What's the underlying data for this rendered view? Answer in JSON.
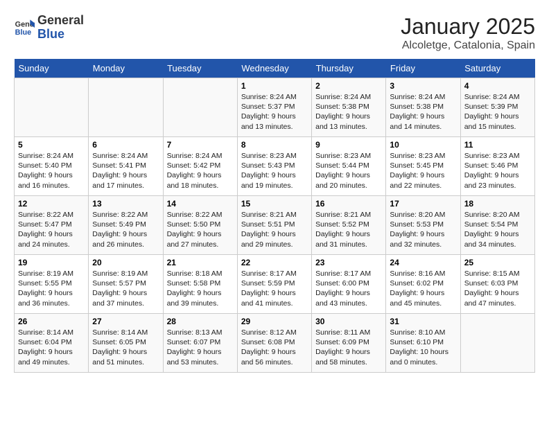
{
  "header": {
    "logo_general": "General",
    "logo_blue": "Blue",
    "month_title": "January 2025",
    "location": "Alcoletge, Catalonia, Spain"
  },
  "days_of_week": [
    "Sunday",
    "Monday",
    "Tuesday",
    "Wednesday",
    "Thursday",
    "Friday",
    "Saturday"
  ],
  "weeks": [
    [
      {
        "num": "",
        "info": ""
      },
      {
        "num": "",
        "info": ""
      },
      {
        "num": "",
        "info": ""
      },
      {
        "num": "1",
        "info": "Sunrise: 8:24 AM\nSunset: 5:37 PM\nDaylight: 9 hours\nand 13 minutes."
      },
      {
        "num": "2",
        "info": "Sunrise: 8:24 AM\nSunset: 5:38 PM\nDaylight: 9 hours\nand 13 minutes."
      },
      {
        "num": "3",
        "info": "Sunrise: 8:24 AM\nSunset: 5:38 PM\nDaylight: 9 hours\nand 14 minutes."
      },
      {
        "num": "4",
        "info": "Sunrise: 8:24 AM\nSunset: 5:39 PM\nDaylight: 9 hours\nand 15 minutes."
      }
    ],
    [
      {
        "num": "5",
        "info": "Sunrise: 8:24 AM\nSunset: 5:40 PM\nDaylight: 9 hours\nand 16 minutes."
      },
      {
        "num": "6",
        "info": "Sunrise: 8:24 AM\nSunset: 5:41 PM\nDaylight: 9 hours\nand 17 minutes."
      },
      {
        "num": "7",
        "info": "Sunrise: 8:24 AM\nSunset: 5:42 PM\nDaylight: 9 hours\nand 18 minutes."
      },
      {
        "num": "8",
        "info": "Sunrise: 8:23 AM\nSunset: 5:43 PM\nDaylight: 9 hours\nand 19 minutes."
      },
      {
        "num": "9",
        "info": "Sunrise: 8:23 AM\nSunset: 5:44 PM\nDaylight: 9 hours\nand 20 minutes."
      },
      {
        "num": "10",
        "info": "Sunrise: 8:23 AM\nSunset: 5:45 PM\nDaylight: 9 hours\nand 22 minutes."
      },
      {
        "num": "11",
        "info": "Sunrise: 8:23 AM\nSunset: 5:46 PM\nDaylight: 9 hours\nand 23 minutes."
      }
    ],
    [
      {
        "num": "12",
        "info": "Sunrise: 8:22 AM\nSunset: 5:47 PM\nDaylight: 9 hours\nand 24 minutes."
      },
      {
        "num": "13",
        "info": "Sunrise: 8:22 AM\nSunset: 5:49 PM\nDaylight: 9 hours\nand 26 minutes."
      },
      {
        "num": "14",
        "info": "Sunrise: 8:22 AM\nSunset: 5:50 PM\nDaylight: 9 hours\nand 27 minutes."
      },
      {
        "num": "15",
        "info": "Sunrise: 8:21 AM\nSunset: 5:51 PM\nDaylight: 9 hours\nand 29 minutes."
      },
      {
        "num": "16",
        "info": "Sunrise: 8:21 AM\nSunset: 5:52 PM\nDaylight: 9 hours\nand 31 minutes."
      },
      {
        "num": "17",
        "info": "Sunrise: 8:20 AM\nSunset: 5:53 PM\nDaylight: 9 hours\nand 32 minutes."
      },
      {
        "num": "18",
        "info": "Sunrise: 8:20 AM\nSunset: 5:54 PM\nDaylight: 9 hours\nand 34 minutes."
      }
    ],
    [
      {
        "num": "19",
        "info": "Sunrise: 8:19 AM\nSunset: 5:55 PM\nDaylight: 9 hours\nand 36 minutes."
      },
      {
        "num": "20",
        "info": "Sunrise: 8:19 AM\nSunset: 5:57 PM\nDaylight: 9 hours\nand 37 minutes."
      },
      {
        "num": "21",
        "info": "Sunrise: 8:18 AM\nSunset: 5:58 PM\nDaylight: 9 hours\nand 39 minutes."
      },
      {
        "num": "22",
        "info": "Sunrise: 8:17 AM\nSunset: 5:59 PM\nDaylight: 9 hours\nand 41 minutes."
      },
      {
        "num": "23",
        "info": "Sunrise: 8:17 AM\nSunset: 6:00 PM\nDaylight: 9 hours\nand 43 minutes."
      },
      {
        "num": "24",
        "info": "Sunrise: 8:16 AM\nSunset: 6:02 PM\nDaylight: 9 hours\nand 45 minutes."
      },
      {
        "num": "25",
        "info": "Sunrise: 8:15 AM\nSunset: 6:03 PM\nDaylight: 9 hours\nand 47 minutes."
      }
    ],
    [
      {
        "num": "26",
        "info": "Sunrise: 8:14 AM\nSunset: 6:04 PM\nDaylight: 9 hours\nand 49 minutes."
      },
      {
        "num": "27",
        "info": "Sunrise: 8:14 AM\nSunset: 6:05 PM\nDaylight: 9 hours\nand 51 minutes."
      },
      {
        "num": "28",
        "info": "Sunrise: 8:13 AM\nSunset: 6:07 PM\nDaylight: 9 hours\nand 53 minutes."
      },
      {
        "num": "29",
        "info": "Sunrise: 8:12 AM\nSunset: 6:08 PM\nDaylight: 9 hours\nand 56 minutes."
      },
      {
        "num": "30",
        "info": "Sunrise: 8:11 AM\nSunset: 6:09 PM\nDaylight: 9 hours\nand 58 minutes."
      },
      {
        "num": "31",
        "info": "Sunrise: 8:10 AM\nSunset: 6:10 PM\nDaylight: 10 hours\nand 0 minutes."
      },
      {
        "num": "",
        "info": ""
      }
    ]
  ]
}
